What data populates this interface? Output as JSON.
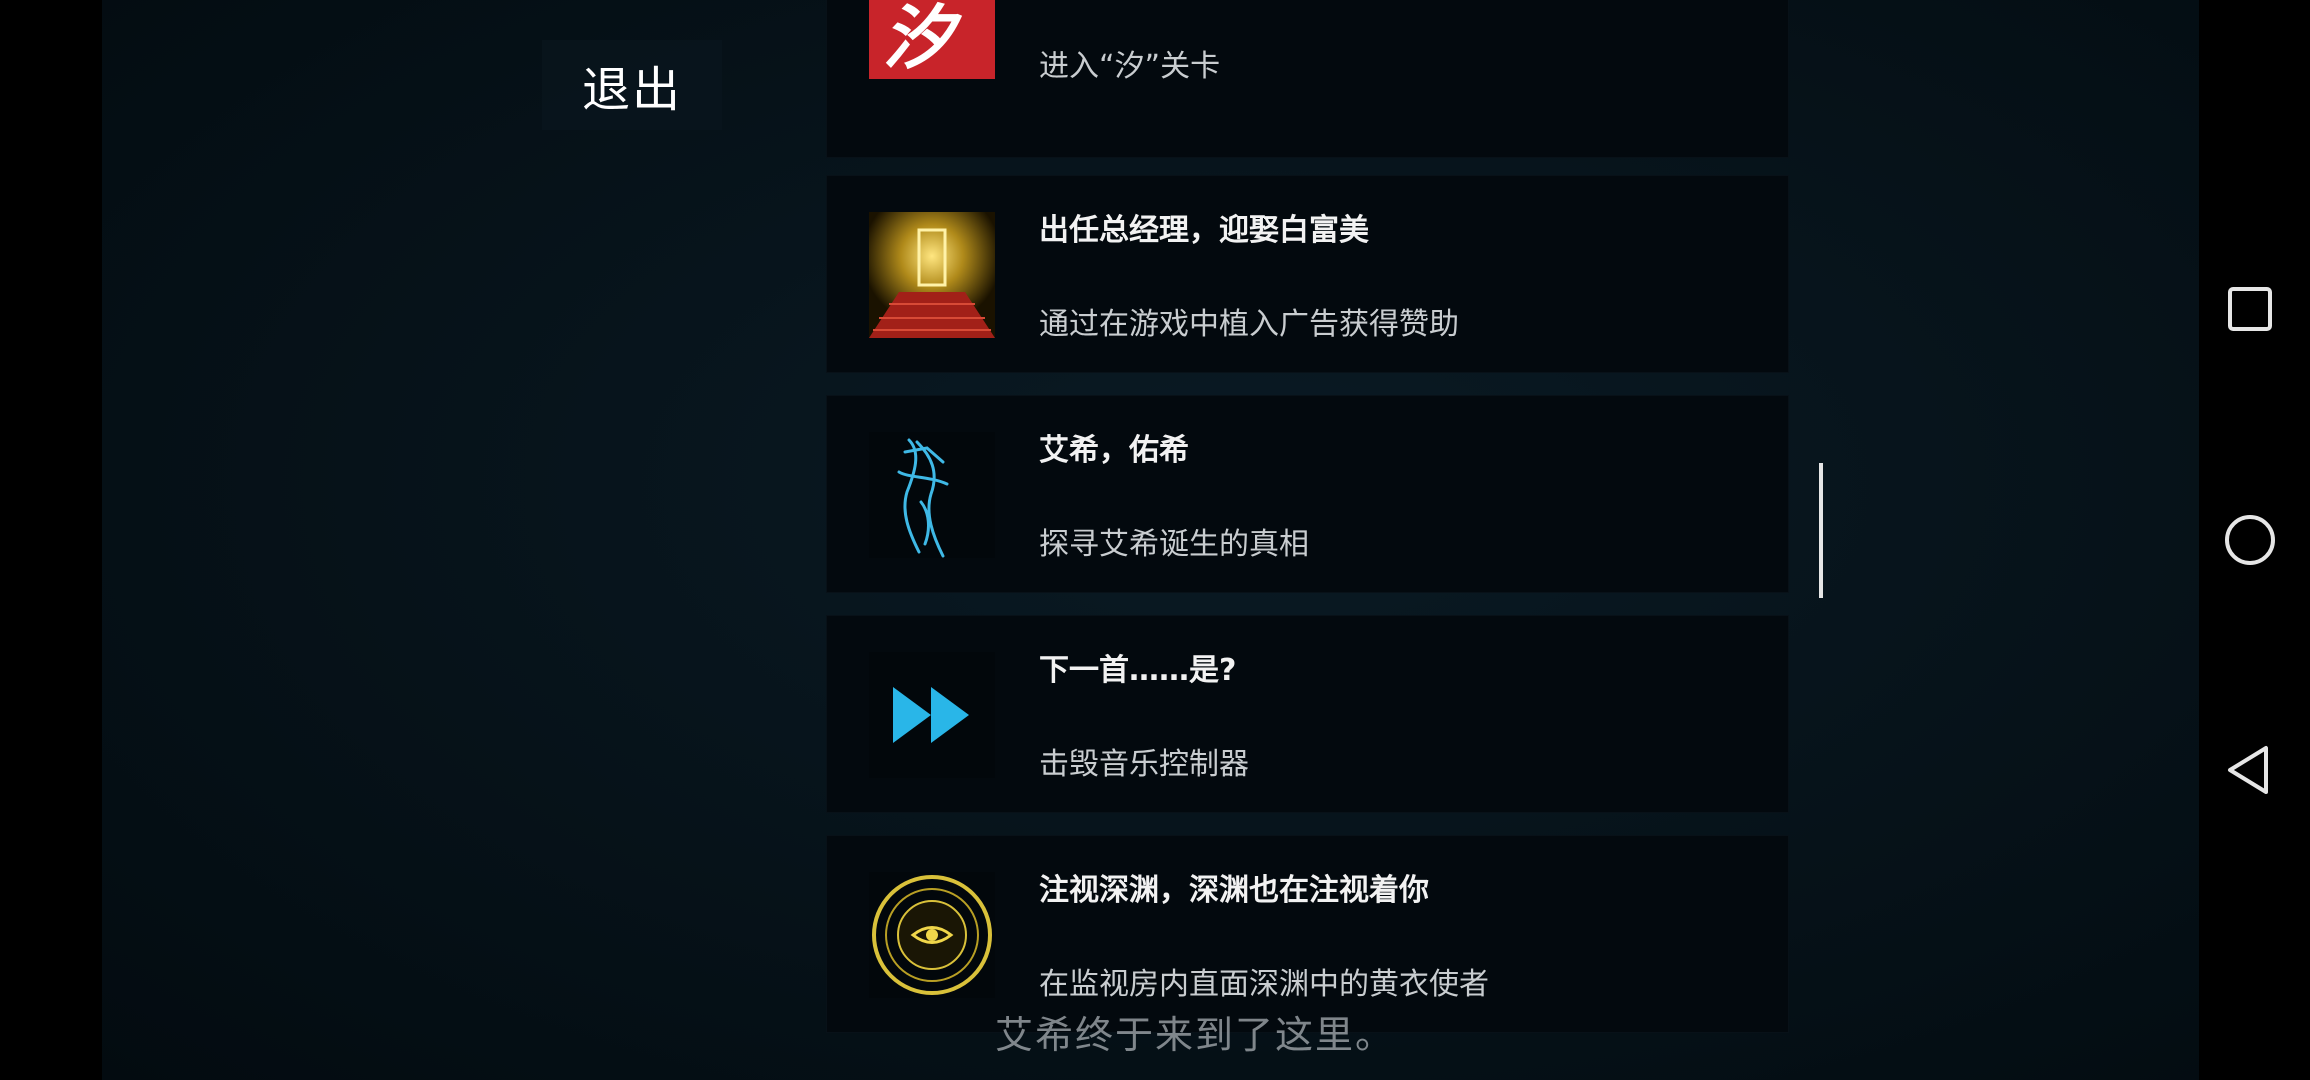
{
  "exit_button": {
    "label": "退出"
  },
  "achievements": [
    {
      "title": "",
      "description": "进入“汐”关卡",
      "icon": "xi-level-icon",
      "icon_glyph": "汐",
      "accent": "#c8242a"
    },
    {
      "title": "出任总经理，迎娶白富美",
      "description": "通过在游戏中植入广告获得赞助",
      "icon": "red-carpet-door-icon",
      "accent": "#e0b030"
    },
    {
      "title": "艾希，佑希",
      "description": "探寻艾希诞生的真相",
      "icon": "cyan-figure-icon",
      "accent": "#3fb9e6"
    },
    {
      "title": "下一首……是?",
      "description": "击毁音乐控制器",
      "icon": "fast-forward-icon",
      "accent": "#29b6e8"
    },
    {
      "title": "注视深渊，深渊也在注视着你",
      "description": "在监视房内直面深渊中的黄衣使者",
      "icon": "yellow-eye-icon",
      "accent": "#d9c13a"
    }
  ],
  "subtitle": "艾希终于来到了这里。",
  "nav": {
    "recent_apps": "square-icon",
    "home": "circle-icon",
    "back": "triangle-back-icon"
  }
}
